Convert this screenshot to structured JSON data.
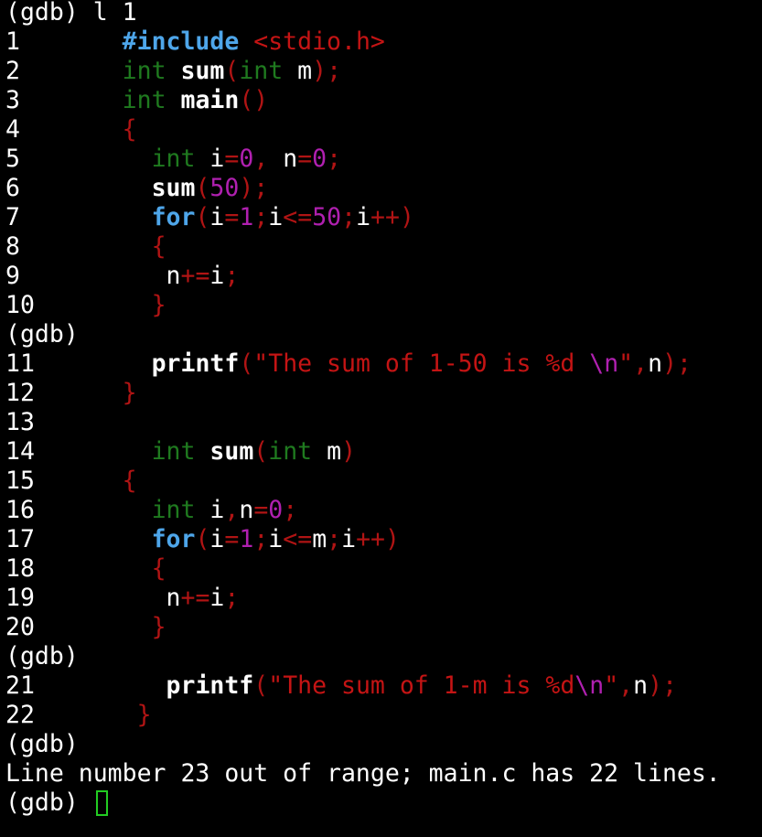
{
  "colors": {
    "background": "#000000",
    "default_text": "#ffffff",
    "preprocessor": "#4ea6ea",
    "control_keyword": "#4ea6ea",
    "type_keyword": "#1f7a1f",
    "punctuation": "#b01414",
    "number_literal": "#b020b0",
    "string_literal": "#c41414",
    "cursor": "#22cc22"
  },
  "terminal": {
    "lines": [
      {
        "kind": "prompt",
        "text": "(gdb) l 1"
      },
      {
        "kind": "code",
        "num": "1",
        "tokens": [
          {
            "c": "pp",
            "t": "#include"
          },
          {
            "c": "id",
            "t": " "
          },
          {
            "c": "str",
            "t": "<stdio.h>"
          }
        ]
      },
      {
        "kind": "code",
        "num": "2",
        "tokens": [
          {
            "c": "type",
            "t": "int"
          },
          {
            "c": "id",
            "t": " "
          },
          {
            "c": "fn",
            "t": "sum"
          },
          {
            "c": "punc",
            "t": "("
          },
          {
            "c": "type",
            "t": "int"
          },
          {
            "c": "id",
            "t": " m"
          },
          {
            "c": "punc",
            "t": ");"
          }
        ]
      },
      {
        "kind": "code",
        "num": "3",
        "tokens": [
          {
            "c": "type",
            "t": "int"
          },
          {
            "c": "id",
            "t": " "
          },
          {
            "c": "fn",
            "t": "main"
          },
          {
            "c": "punc",
            "t": "()"
          }
        ]
      },
      {
        "kind": "code",
        "num": "4",
        "tokens": [
          {
            "c": "punc",
            "t": "{"
          }
        ]
      },
      {
        "kind": "code",
        "num": "5",
        "tokens": [
          {
            "c": "id",
            "t": "  "
          },
          {
            "c": "type",
            "t": "int"
          },
          {
            "c": "id",
            "t": " i"
          },
          {
            "c": "punc",
            "t": "="
          },
          {
            "c": "num",
            "t": "0"
          },
          {
            "c": "punc",
            "t": ","
          },
          {
            "c": "id",
            "t": " n"
          },
          {
            "c": "punc",
            "t": "="
          },
          {
            "c": "num",
            "t": "0"
          },
          {
            "c": "punc",
            "t": ";"
          }
        ]
      },
      {
        "kind": "code",
        "num": "6",
        "tokens": [
          {
            "c": "id",
            "t": "  "
          },
          {
            "c": "fn",
            "t": "sum"
          },
          {
            "c": "punc",
            "t": "("
          },
          {
            "c": "num",
            "t": "50"
          },
          {
            "c": "punc",
            "t": ");"
          }
        ]
      },
      {
        "kind": "code",
        "num": "7",
        "tokens": [
          {
            "c": "id",
            "t": "  "
          },
          {
            "c": "ctl",
            "t": "for"
          },
          {
            "c": "punc",
            "t": "("
          },
          {
            "c": "id",
            "t": "i"
          },
          {
            "c": "punc",
            "t": "="
          },
          {
            "c": "num",
            "t": "1"
          },
          {
            "c": "punc",
            "t": ";"
          },
          {
            "c": "id",
            "t": "i"
          },
          {
            "c": "punc",
            "t": "<="
          },
          {
            "c": "num",
            "t": "50"
          },
          {
            "c": "punc",
            "t": ";"
          },
          {
            "c": "id",
            "t": "i"
          },
          {
            "c": "punc",
            "t": "++)"
          }
        ]
      },
      {
        "kind": "code",
        "num": "8",
        "tokens": [
          {
            "c": "id",
            "t": "  "
          },
          {
            "c": "punc",
            "t": "{"
          }
        ]
      },
      {
        "kind": "code",
        "num": "9",
        "tokens": [
          {
            "c": "id",
            "t": "   n"
          },
          {
            "c": "punc",
            "t": "+="
          },
          {
            "c": "id",
            "t": "i"
          },
          {
            "c": "punc",
            "t": ";"
          }
        ]
      },
      {
        "kind": "code",
        "num": "10",
        "tokens": [
          {
            "c": "id",
            "t": "  "
          },
          {
            "c": "punc",
            "t": "}"
          }
        ]
      },
      {
        "kind": "prompt",
        "text": "(gdb)"
      },
      {
        "kind": "code",
        "num": "11",
        "tokens": [
          {
            "c": "id",
            "t": "  "
          },
          {
            "c": "fn",
            "t": "printf"
          },
          {
            "c": "punc",
            "t": "("
          },
          {
            "c": "str",
            "t": "\"The sum of 1-50 is %d "
          },
          {
            "c": "esc",
            "t": "\\n"
          },
          {
            "c": "str",
            "t": "\""
          },
          {
            "c": "punc",
            "t": ","
          },
          {
            "c": "id",
            "t": "n"
          },
          {
            "c": "punc",
            "t": ");"
          }
        ]
      },
      {
        "kind": "code",
        "num": "12",
        "tokens": [
          {
            "c": "punc",
            "t": "}"
          }
        ]
      },
      {
        "kind": "code",
        "num": "13",
        "tokens": []
      },
      {
        "kind": "code",
        "num": "14",
        "tokens": [
          {
            "c": "id",
            "t": "  "
          },
          {
            "c": "type",
            "t": "int"
          },
          {
            "c": "id",
            "t": " "
          },
          {
            "c": "fn",
            "t": "sum"
          },
          {
            "c": "punc",
            "t": "("
          },
          {
            "c": "type",
            "t": "int"
          },
          {
            "c": "id",
            "t": " m"
          },
          {
            "c": "punc",
            "t": ")"
          }
        ]
      },
      {
        "kind": "code",
        "num": "15",
        "tokens": [
          {
            "c": "punc",
            "t": "{"
          }
        ]
      },
      {
        "kind": "code",
        "num": "16",
        "tokens": [
          {
            "c": "id",
            "t": "  "
          },
          {
            "c": "type",
            "t": "int"
          },
          {
            "c": "id",
            "t": " i"
          },
          {
            "c": "punc",
            "t": ","
          },
          {
            "c": "id",
            "t": "n"
          },
          {
            "c": "punc",
            "t": "="
          },
          {
            "c": "num",
            "t": "0"
          },
          {
            "c": "punc",
            "t": ";"
          }
        ]
      },
      {
        "kind": "code",
        "num": "17",
        "tokens": [
          {
            "c": "id",
            "t": "  "
          },
          {
            "c": "ctl",
            "t": "for"
          },
          {
            "c": "punc",
            "t": "("
          },
          {
            "c": "id",
            "t": "i"
          },
          {
            "c": "punc",
            "t": "="
          },
          {
            "c": "num",
            "t": "1"
          },
          {
            "c": "punc",
            "t": ";"
          },
          {
            "c": "id",
            "t": "i"
          },
          {
            "c": "punc",
            "t": "<="
          },
          {
            "c": "id",
            "t": "m"
          },
          {
            "c": "punc",
            "t": ";"
          },
          {
            "c": "id",
            "t": "i"
          },
          {
            "c": "punc",
            "t": "++)"
          }
        ]
      },
      {
        "kind": "code",
        "num": "18",
        "tokens": [
          {
            "c": "id",
            "t": "  "
          },
          {
            "c": "punc",
            "t": "{"
          }
        ]
      },
      {
        "kind": "code",
        "num": "19",
        "tokens": [
          {
            "c": "id",
            "t": "   n"
          },
          {
            "c": "punc",
            "t": "+="
          },
          {
            "c": "id",
            "t": "i"
          },
          {
            "c": "punc",
            "t": ";"
          }
        ]
      },
      {
        "kind": "code",
        "num": "20",
        "tokens": [
          {
            "c": "id",
            "t": "  "
          },
          {
            "c": "punc",
            "t": "}"
          }
        ]
      },
      {
        "kind": "prompt",
        "text": "(gdb)"
      },
      {
        "kind": "code",
        "num": "21",
        "tokens": [
          {
            "c": "id",
            "t": "   "
          },
          {
            "c": "fn",
            "t": "printf"
          },
          {
            "c": "punc",
            "t": "("
          },
          {
            "c": "str",
            "t": "\"The sum of 1-m is %d"
          },
          {
            "c": "esc",
            "t": "\\n"
          },
          {
            "c": "str",
            "t": "\""
          },
          {
            "c": "punc",
            "t": ","
          },
          {
            "c": "id",
            "t": "n"
          },
          {
            "c": "punc",
            "t": ");"
          }
        ]
      },
      {
        "kind": "code",
        "num": "22",
        "tokens": [
          {
            "c": "id",
            "t": " "
          },
          {
            "c": "punc",
            "t": "}"
          }
        ]
      },
      {
        "kind": "prompt",
        "text": "(gdb)"
      },
      {
        "kind": "message",
        "text": "Line number 23 out of range; main.c has 22 lines."
      },
      {
        "kind": "input",
        "text": "(gdb) "
      }
    ]
  }
}
